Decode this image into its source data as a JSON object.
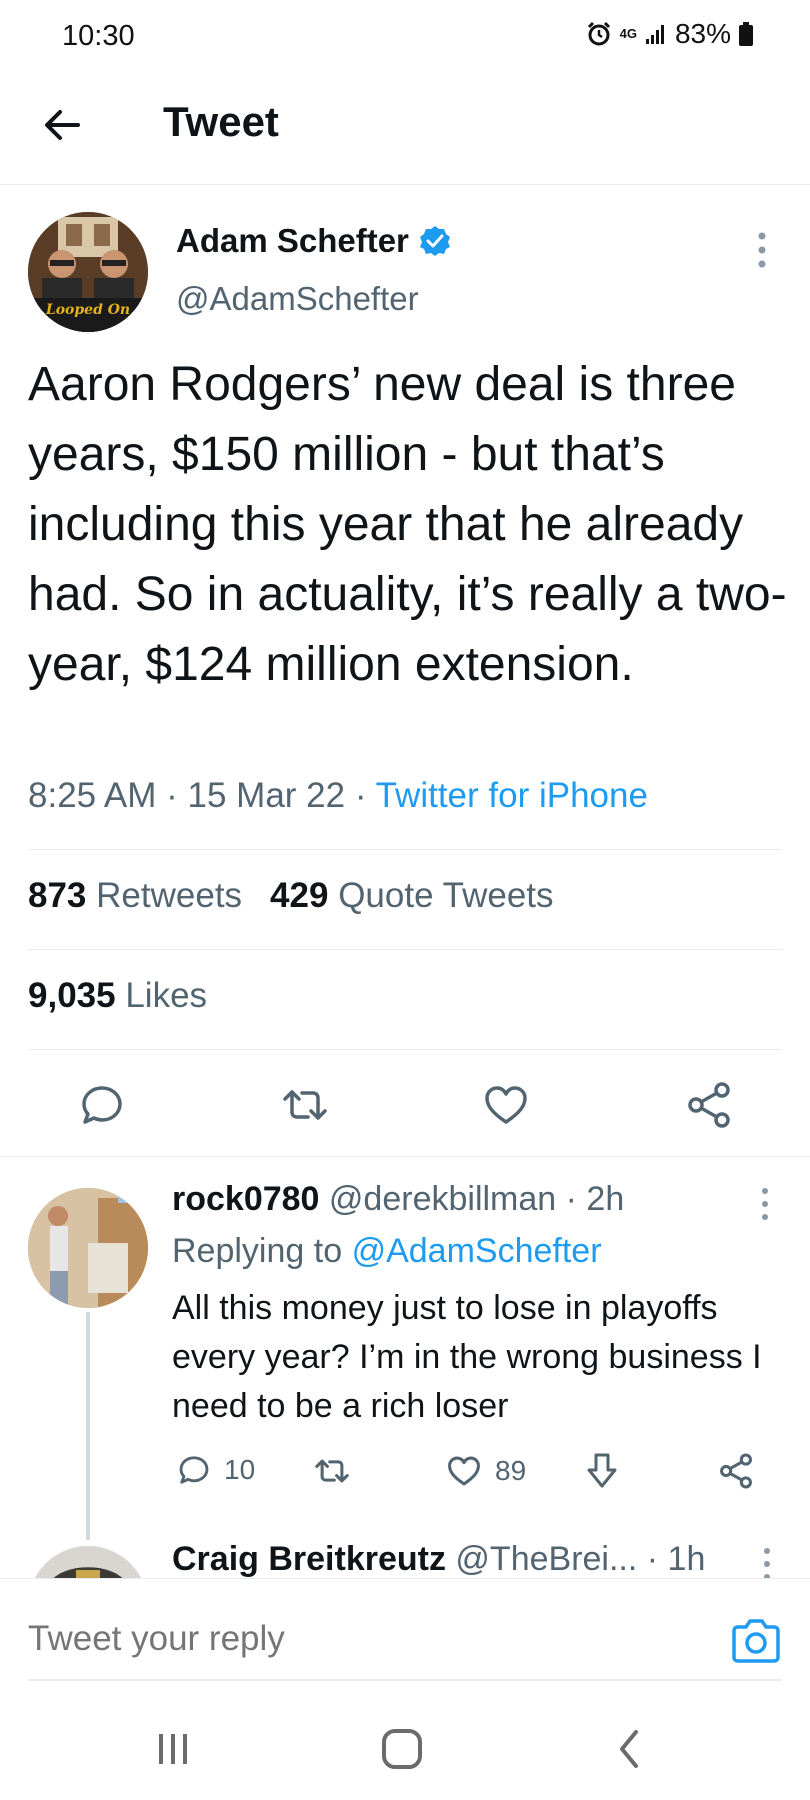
{
  "status_bar": {
    "time": "10:30",
    "network": "4G",
    "battery": "83%"
  },
  "header": {
    "title": "Tweet"
  },
  "tweet": {
    "author_name": "Adam Schefter",
    "author_handle": "@AdamSchefter",
    "avatar_text": "Looped On",
    "text": "Aaron Rodgers’ new deal is three years, $150 million - but that’s including this year that he already had. So in actuality, it’s really a two-year, $124 million extension.",
    "time": "8:25 AM",
    "date": "15 Mar 22",
    "separator": " · ",
    "source": "Twitter for iPhone",
    "retweets_count": "873",
    "retweets_label": "Retweets",
    "quotes_count": "429",
    "quotes_label": "Quote Tweets",
    "likes_count": "9,035",
    "likes_label": "Likes"
  },
  "reply": {
    "name": "rock0780",
    "handle": "@derekbillman",
    "time": "· 2h",
    "replying_prefix": "Replying to",
    "replying_handle": "@AdamSchefter",
    "text": "All this money just to lose in playoffs every year? I’m in the wrong business I need to be a rich loser",
    "reply_count": "10",
    "like_count": "89"
  },
  "reply2": {
    "name": "Craig Breitkreutz",
    "handle": "@TheBrei...",
    "time": "· 1h"
  },
  "composer": {
    "placeholder": "Tweet your reply"
  },
  "colors": {
    "accent": "#1d9bf0",
    "secondary_text": "#536471",
    "divider": "#e6ecf0"
  }
}
